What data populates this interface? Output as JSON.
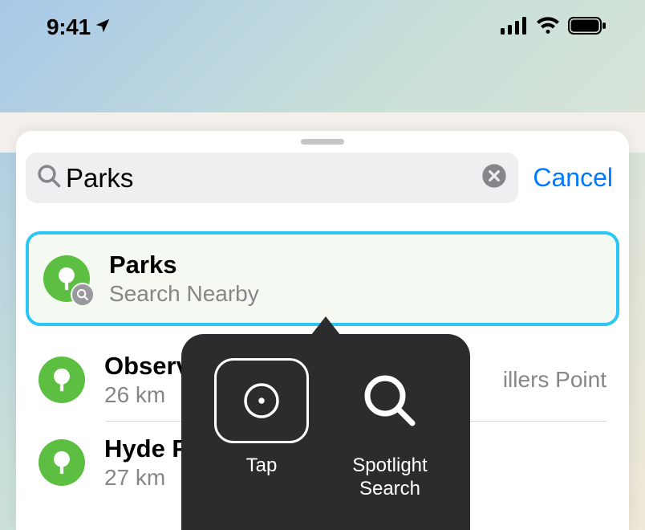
{
  "status": {
    "time": "9:41"
  },
  "search": {
    "value": "Parks",
    "cancel_label": "Cancel"
  },
  "results": {
    "primary": {
      "title": "Parks",
      "subtitle": "Search Nearby"
    },
    "items": [
      {
        "title": "Observ",
        "subtitle": "26 km",
        "trailing": "illers Point"
      },
      {
        "title": "Hyde P",
        "subtitle": "27 km"
      }
    ]
  },
  "popover": {
    "tap": "Tap",
    "spotlight": "Spotlight Search"
  }
}
